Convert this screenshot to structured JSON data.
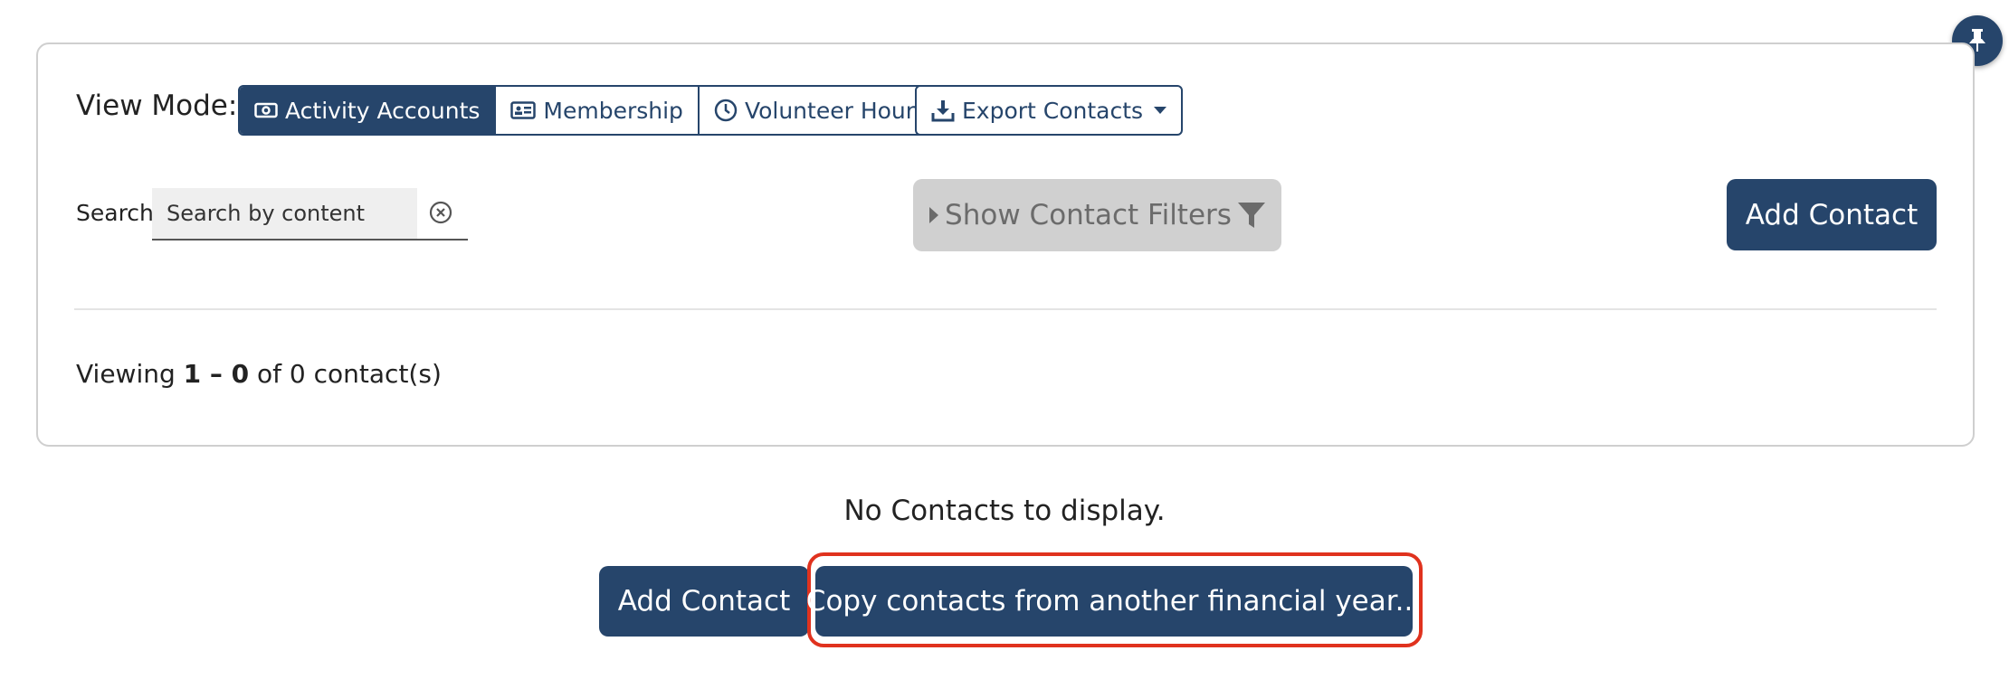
{
  "pin_button": {
    "icon": "pin-icon"
  },
  "view_mode": {
    "label": "View Mode:",
    "options": [
      {
        "label": "Activity Accounts",
        "icon": "money-icon",
        "active": true
      },
      {
        "label": "Membership",
        "icon": "id-card-icon",
        "active": false
      },
      {
        "label": "Volunteer Hours",
        "icon": "clock-icon",
        "active": false
      }
    ]
  },
  "export": {
    "label": "Export Contacts",
    "icon": "download-icon"
  },
  "search": {
    "label": "Search",
    "placeholder": "Search by content",
    "value": ""
  },
  "filters": {
    "label": "Show Contact Filters"
  },
  "add_contact_top": {
    "label": "Add Contact"
  },
  "viewing": {
    "prefix": "Viewing ",
    "range": "1 – 0",
    "middle": " of ",
    "total": "0",
    "suffix": " contact(s)"
  },
  "empty": {
    "message": "No Contacts to display.",
    "add_label": "Add Contact",
    "copy_label": "Copy contacts from another financial year..."
  },
  "colors": {
    "primary": "#26456b",
    "highlight": "#e0321e",
    "disabled_bg": "#d0d0d0"
  }
}
